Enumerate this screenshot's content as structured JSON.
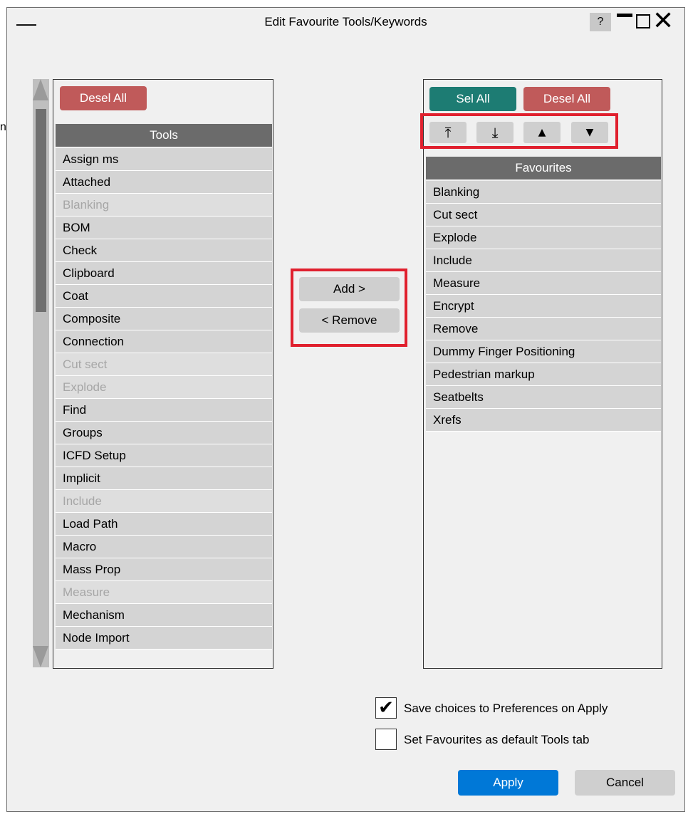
{
  "window": {
    "title": "Edit Favourite Tools/Keywords",
    "help_label": "?",
    "menu_glyph": "—",
    "close_glyph": "✕"
  },
  "tools_panel": {
    "desel_all_label": "Desel All",
    "header": "Tools",
    "items": [
      {
        "label": "Assign ms",
        "dimmed": false
      },
      {
        "label": "Attached",
        "dimmed": false
      },
      {
        "label": "Blanking",
        "dimmed": true
      },
      {
        "label": "BOM",
        "dimmed": false
      },
      {
        "label": "Check",
        "dimmed": false
      },
      {
        "label": "Clipboard",
        "dimmed": false
      },
      {
        "label": "Coat",
        "dimmed": false
      },
      {
        "label": "Composite",
        "dimmed": false
      },
      {
        "label": "Connection",
        "dimmed": false
      },
      {
        "label": "Cut sect",
        "dimmed": true
      },
      {
        "label": "Explode",
        "dimmed": true
      },
      {
        "label": "Find",
        "dimmed": false
      },
      {
        "label": "Groups",
        "dimmed": false
      },
      {
        "label": "ICFD Setup",
        "dimmed": false
      },
      {
        "label": "Implicit",
        "dimmed": false
      },
      {
        "label": "Include",
        "dimmed": true
      },
      {
        "label": "Load Path",
        "dimmed": false
      },
      {
        "label": "Macro",
        "dimmed": false
      },
      {
        "label": "Mass Prop",
        "dimmed": false
      },
      {
        "label": "Measure",
        "dimmed": true
      },
      {
        "label": "Mechanism",
        "dimmed": false
      },
      {
        "label": "Node Import",
        "dimmed": false
      }
    ]
  },
  "middle": {
    "add_label": "Add >",
    "remove_label": "< Remove"
  },
  "favourites_panel": {
    "sel_all_label": "Sel All",
    "desel_all_label": "Desel All",
    "move_top_glyph": "⤒",
    "move_bottom_glyph": "⤓",
    "move_up_glyph": "▲",
    "move_down_glyph": "▼",
    "header": "Favourites",
    "items": [
      "Blanking",
      "Cut sect",
      "Explode",
      "Include",
      "Measure",
      "Encrypt",
      "Remove",
      "Dummy Finger Positioning",
      "Pedestrian markup",
      "Seatbelts",
      "Xrefs"
    ]
  },
  "options": {
    "save_choices_label": "Save choices to Preferences on Apply",
    "save_choices_checked": true,
    "default_tab_label": "Set Favourites as default Tools tab",
    "default_tab_checked": false,
    "check_glyph": "✔"
  },
  "actions": {
    "apply_label": "Apply",
    "cancel_label": "Cancel"
  },
  "stray_text": "n",
  "colors": {
    "accent": "#0078d7",
    "red_button": "#c05a5a",
    "teal_button": "#1d7c73",
    "highlight": "#e0202e"
  }
}
